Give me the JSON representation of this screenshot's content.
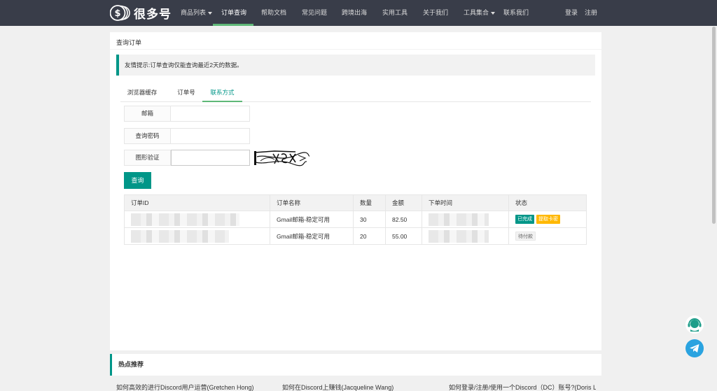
{
  "nav": {
    "logo_text": "很多号",
    "items": [
      {
        "label": "商品列表",
        "has_caret": true
      },
      {
        "label": "订单查询",
        "active": true
      },
      {
        "label": "帮助文档"
      },
      {
        "label": "常见问题"
      },
      {
        "label": "跨境出海"
      },
      {
        "label": "实用工具"
      },
      {
        "label": "关于我们"
      },
      {
        "label": "工具集合",
        "has_caret": true
      },
      {
        "label": "联系我们"
      }
    ],
    "login": "登录",
    "register": "注册"
  },
  "card": {
    "title": "查询订单",
    "notice": "友情提示:订单查询仅能查询最近2天的数据。"
  },
  "tabs": [
    "浏览器缓存",
    "订单号",
    "联系方式"
  ],
  "active_tab": "联系方式",
  "form": {
    "email_label": "邮箱",
    "email_value": "",
    "password_label": "查询密码",
    "password_value": "",
    "captcha_label": "图形验证",
    "captcha_value": "",
    "submit_label": "查询"
  },
  "table": {
    "headers": [
      "订单ID",
      "订单名称",
      "数量",
      "金额",
      "下单时间",
      "状态"
    ],
    "rows": [
      {
        "name": "Gmail邮箱-稳定可用",
        "qty": "30",
        "amount": "82.50",
        "status": "已完成",
        "action": "提取卡密"
      },
      {
        "name": "Gmail邮箱-稳定可用",
        "qty": "20",
        "amount": "55.00",
        "status": "待付款"
      }
    ]
  },
  "hot": {
    "title": "热点推荐",
    "links": [
      "如何高效的进行Discord用户运营(Gretchen Hong)",
      "如何在Discord上赚钱(Jacqueline Wang)",
      "如何登录/注册/使用一个Discord（DC）账号?(Doris L..."
    ]
  },
  "colors": {
    "nav_bg": "#393d49",
    "accent": "#009688",
    "active_underline": "#5fb878",
    "badge_warn": "#ffb800",
    "telegram": "#2aa3e0"
  },
  "icons": {
    "support": "headset-icon",
    "telegram": "telegram-icon",
    "logo": "coins-logo-icon"
  }
}
